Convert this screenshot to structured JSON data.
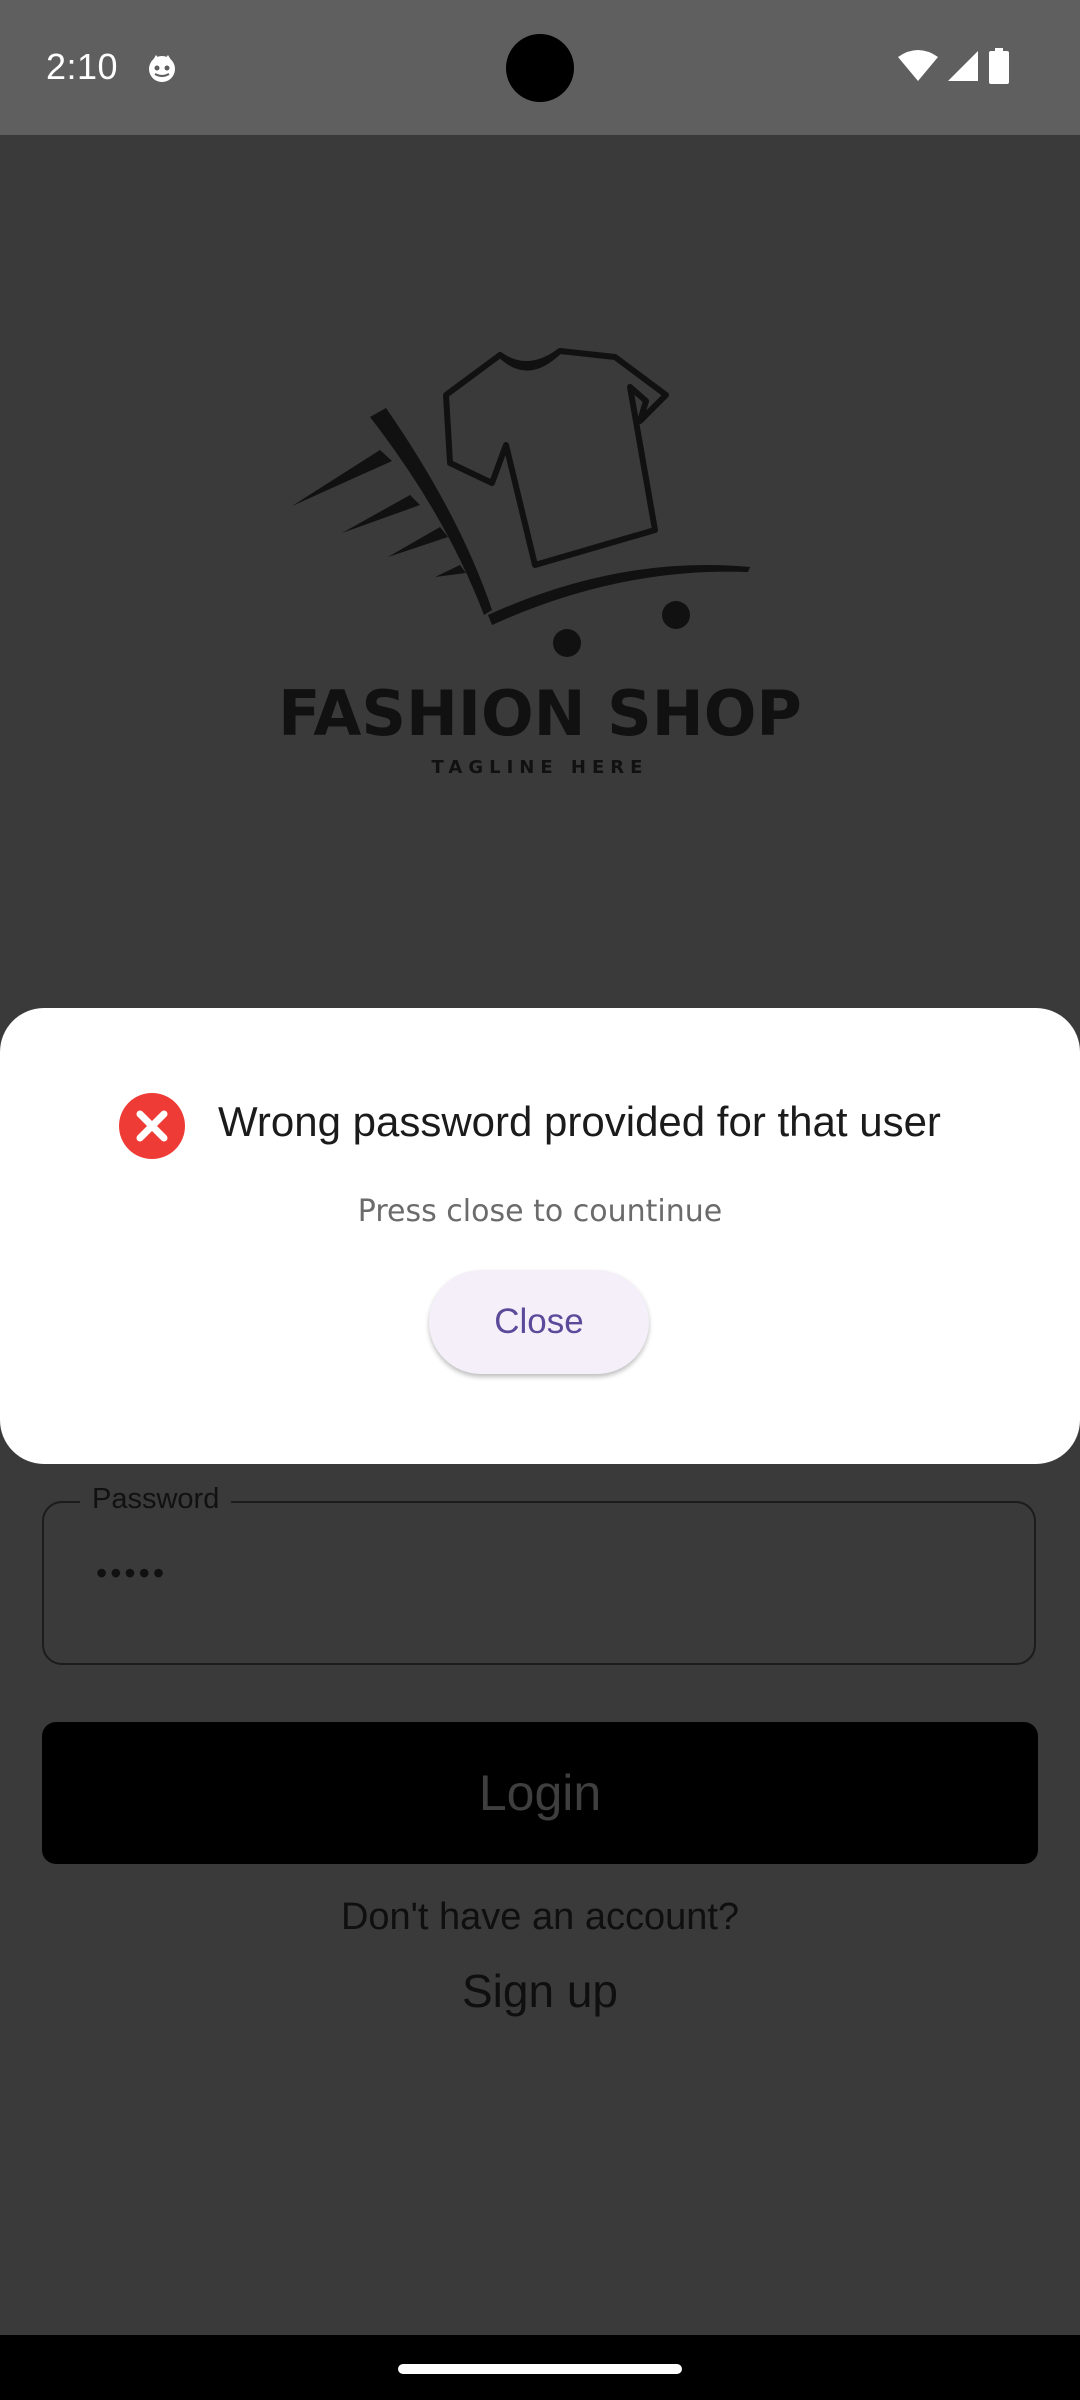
{
  "status_bar": {
    "time": "2:10"
  },
  "login_screen": {
    "logo_title": "FASHION SHOP",
    "logo_tagline": "TAGLINE HERE",
    "password_label": "Password",
    "password_value": "•••••",
    "login_label": "Login",
    "no_account_text": "Don't have an account?",
    "signup_label": "Sign up"
  },
  "dialog": {
    "title": "Wrong password provided for that user",
    "message": "Press close to countinue",
    "close_label": "Close",
    "icon": "error-icon",
    "colors": {
      "error": "#ef3b35",
      "button_text": "#5b4a9a"
    }
  },
  "colors": {
    "scrim": "#3a3a3a",
    "dialog_bg": "#ffffff"
  }
}
